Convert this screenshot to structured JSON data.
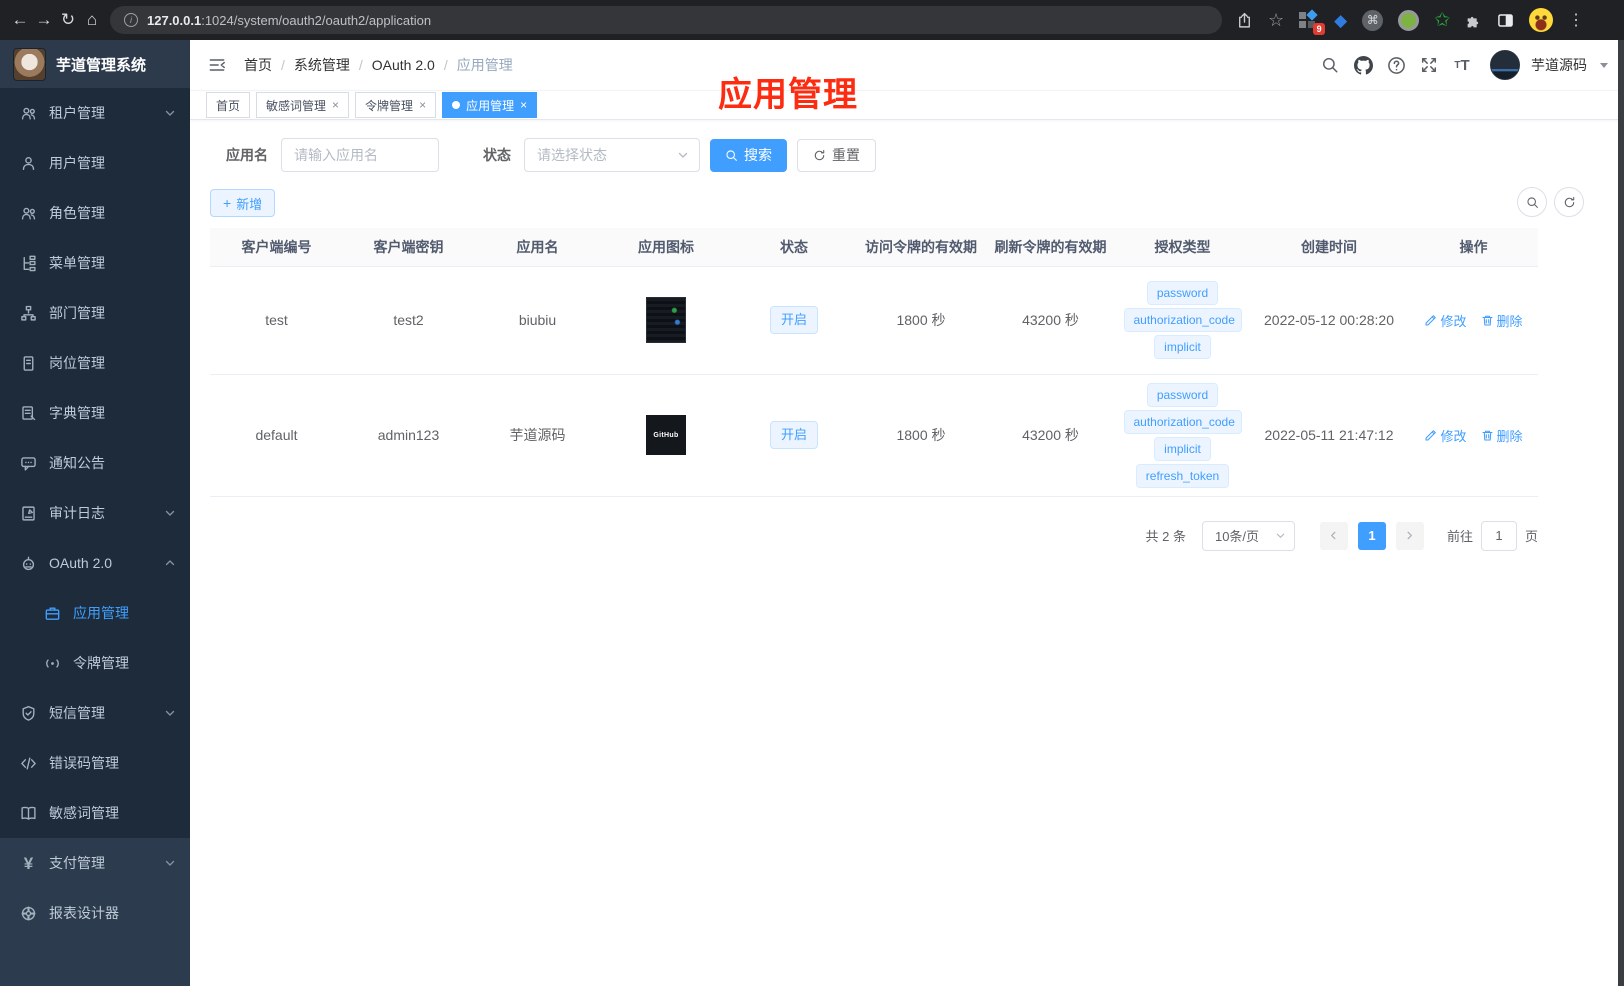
{
  "browser": {
    "url": {
      "host": "127.0.0.1",
      "rest": ":1024/system/oauth2/oauth2/application"
    },
    "extension_badge": "9",
    "icons": [
      "back",
      "forward",
      "refresh",
      "home",
      "info",
      "share",
      "bookmark-star",
      "extension-grid",
      "kite",
      "command-circle",
      "record-circle",
      "green-star",
      "puzzle",
      "split-view",
      "emoji-avatar",
      "more-menu"
    ]
  },
  "sidebar": {
    "logo_title": "芋道管理系统",
    "items": [
      {
        "label": "租户管理",
        "icon": "users",
        "chevron": "down"
      },
      {
        "label": "用户管理",
        "icon": "user"
      },
      {
        "label": "角色管理",
        "icon": "role-users"
      },
      {
        "label": "菜单管理",
        "icon": "menu-tree"
      },
      {
        "label": "部门管理",
        "icon": "org-chart"
      },
      {
        "label": "岗位管理",
        "icon": "id-badge"
      },
      {
        "label": "字典管理",
        "icon": "dictionary"
      },
      {
        "label": "通知公告",
        "icon": "announcement"
      },
      {
        "label": "审计日志",
        "icon": "audit-log",
        "chevron": "down"
      },
      {
        "label": "OAuth 2.0",
        "icon": "robot",
        "chevron": "up",
        "expanded": true
      },
      {
        "label": "应用管理",
        "icon": "briefcase",
        "sub": true,
        "active": true
      },
      {
        "label": "令牌管理",
        "icon": "signal",
        "sub": true
      },
      {
        "label": "短信管理",
        "icon": "shield-check",
        "chevron": "down"
      },
      {
        "label": "错误码管理",
        "icon": "code"
      },
      {
        "label": "敏感词管理",
        "icon": "open-book"
      },
      {
        "label": "支付管理",
        "icon": "yen",
        "chevron": "down"
      },
      {
        "label": "报表设计器",
        "icon": "report-wheel"
      }
    ]
  },
  "header": {
    "breadcrumb": [
      "首页",
      "系统管理",
      "OAuth 2.0",
      "应用管理"
    ],
    "breadcrumb_separator": "/",
    "icons": [
      "search",
      "github",
      "help",
      "fullscreen",
      "font-size"
    ],
    "username": "芋道源码"
  },
  "tabs": [
    {
      "label": "首页",
      "closable": false,
      "active": false
    },
    {
      "label": "敏感词管理",
      "closable": true,
      "active": false
    },
    {
      "label": "令牌管理",
      "closable": true,
      "active": false
    },
    {
      "label": "应用管理",
      "closable": true,
      "active": true
    }
  ],
  "annotation": {
    "text": "应用管理",
    "color": "#fd2b10"
  },
  "filter": {
    "name_label": "应用名",
    "name_placeholder": "请输入应用名",
    "status_label": "状态",
    "status_placeholder": "请选择状态",
    "search_label": "搜索",
    "reset_label": "重置"
  },
  "toolbar": {
    "add_label": "新增"
  },
  "table": {
    "columns": [
      "客户端编号",
      "客户端密钥",
      "应用名",
      "应用图标",
      "状态",
      "访问令牌的有效期",
      "刷新令牌的有效期",
      "授权类型",
      "创建时间",
      "操作"
    ],
    "edit_label": "修改",
    "delete_label": "删除",
    "rows": [
      {
        "client_id": "test",
        "secret": "test2",
        "name": "biubiu",
        "icon_type": "dashboard-screenshot-thumbnail",
        "status": "开启",
        "access_ttl": "1800 秒",
        "refresh_ttl": "43200 秒",
        "grant_types": [
          "password",
          "authorization_code",
          "implicit"
        ],
        "created": "2022-05-12 00:28:20"
      },
      {
        "client_id": "default",
        "secret": "admin123",
        "name": "芋道源码",
        "icon_type": "github-dark-thumbnail",
        "icon_text": "GitHub",
        "status": "开启",
        "access_ttl": "1800 秒",
        "refresh_ttl": "43200 秒",
        "grant_types": [
          "password",
          "authorization_code",
          "implicit",
          "refresh_token"
        ],
        "created": "2022-05-11 21:47:12"
      }
    ]
  },
  "pagination": {
    "total": "共 2 条",
    "page_size": "10条/页",
    "current_page": "1",
    "goto_label": "前往",
    "goto_value": "1",
    "page_label": "页"
  },
  "colors": {
    "primary": "#409eff",
    "sidebar_bg": "#1d2b3a",
    "annotation_red": "#fd2b10",
    "tag_bg": "#ecf5ff"
  }
}
